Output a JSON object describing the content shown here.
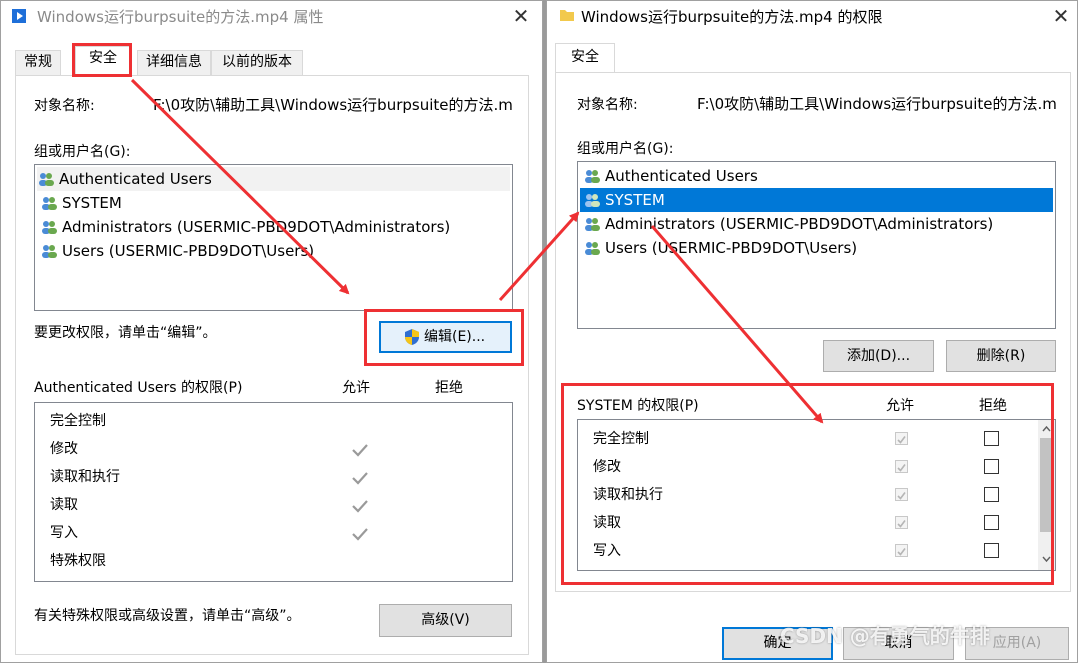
{
  "properties_dialog": {
    "title": "Windows运行burpsuite的方法.mp4 属性",
    "tabs": [
      {
        "label": "常规"
      },
      {
        "label": "安全"
      },
      {
        "label": "详细信息"
      },
      {
        "label": "以前的版本"
      }
    ],
    "object_name_label": "对象名称:",
    "object_name_value": "F:\\0攻防\\辅助工具\\Windows运行burpsuite的方法.m",
    "groups_label": "组或用户名(G):",
    "groups": [
      {
        "name": "Authenticated Users"
      },
      {
        "name": "SYSTEM"
      },
      {
        "name": "Administrators (USERMIC-PBD9DOT\\Administrators)"
      },
      {
        "name": "Users (USERMIC-PBD9DOT\\Users)"
      }
    ],
    "change_hint": "要更改权限，请单击“编辑”。",
    "edit_button": "编辑(E)...",
    "permissions_label": "Authenticated Users 的权限(P)",
    "allow_header": "允许",
    "deny_header": "拒绝",
    "permissions": [
      {
        "name": "完全控制",
        "allow": false
      },
      {
        "name": "修改",
        "allow": true
      },
      {
        "name": "读取和执行",
        "allow": true
      },
      {
        "name": "读取",
        "allow": true
      },
      {
        "name": "写入",
        "allow": true
      },
      {
        "name": "特殊权限",
        "allow": false
      }
    ],
    "advanced_hint": "有关特殊权限或高级设置，请单击“高级”。",
    "advanced_button": "高级(V)"
  },
  "permissions_dialog": {
    "title": "Windows运行burpsuite的方法.mp4 的权限",
    "tab": "安全",
    "object_name_label": "对象名称:",
    "object_name_value": "F:\\0攻防\\辅助工具\\Windows运行burpsuite的方法.m",
    "groups_label": "组或用户名(G):",
    "groups": [
      {
        "name": "Authenticated Users",
        "selected": false
      },
      {
        "name": "SYSTEM",
        "selected": true
      },
      {
        "name": "Administrators (USERMIC-PBD9DOT\\Administrators)",
        "selected": false
      },
      {
        "name": "Users (USERMIC-PBD9DOT\\Users)",
        "selected": false
      }
    ],
    "add_button": "添加(D)...",
    "remove_button": "删除(R)",
    "permissions_label": "SYSTEM 的权限(P)",
    "allow_header": "允许",
    "deny_header": "拒绝",
    "permissions": [
      {
        "name": "完全控制",
        "allow": true,
        "deny": false
      },
      {
        "name": "修改",
        "allow": true,
        "deny": false
      },
      {
        "name": "读取和执行",
        "allow": true,
        "deny": false
      },
      {
        "name": "读取",
        "allow": true,
        "deny": false
      },
      {
        "name": "写入",
        "allow": true,
        "deny": false
      }
    ],
    "ok_button": "确定",
    "cancel_button": "取消",
    "apply_button": "应用(A)"
  },
  "watermark": "CSDN @有勇气的牛排",
  "colors": {
    "annotation_red": "#ee3033",
    "selection_blue": "#0078d7"
  }
}
